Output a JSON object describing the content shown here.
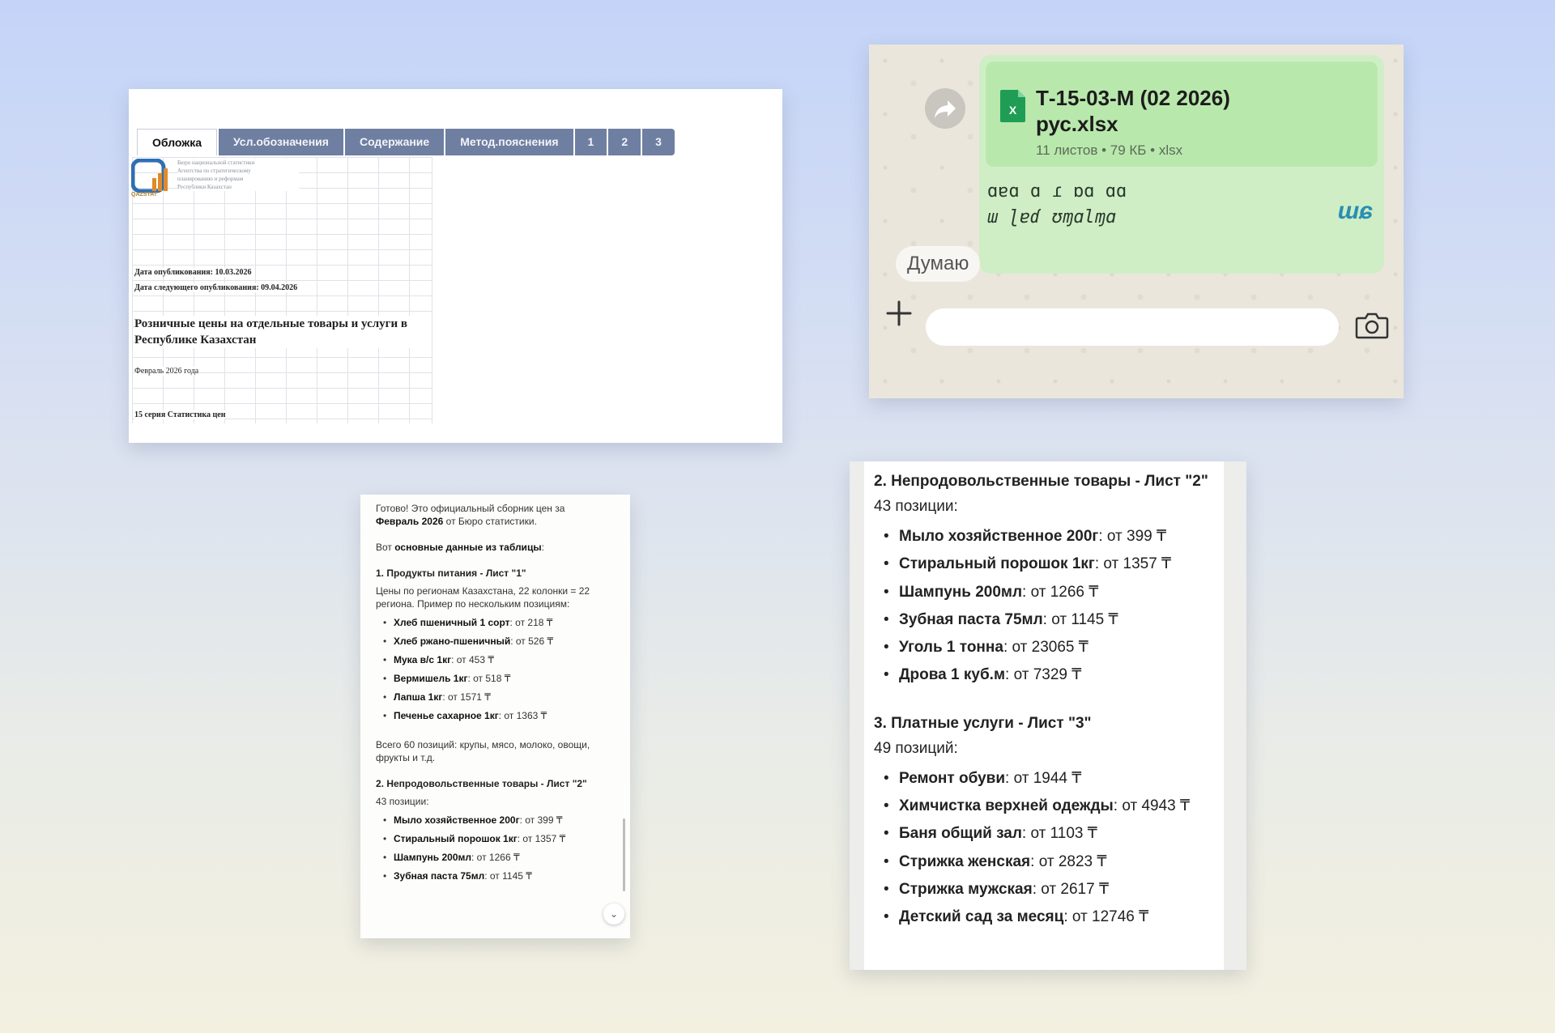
{
  "spreadsheet": {
    "tabs": [
      "Обложка",
      "Усл.обозначения",
      "Содержание",
      "Метод.пояснения",
      "1",
      "2",
      "3"
    ],
    "logo_caption": "QAZSTAT",
    "org_lines": [
      "Бюро национальной статистики",
      "Агентства по стратегическому",
      "планированию и реформам",
      "Республики Казахстан"
    ],
    "published": "Дата опубликования: 10.03.2026",
    "next_published": "Дата следующего опубликования: 09.04.2026",
    "title": "Розничные цены на отдельные товары и услуги в Республике Казахстан",
    "period": "Февраль 2026 года",
    "series": "15 серия Статистика цен"
  },
  "chat": {
    "file_name_line1": "Т-15-03-М (02 2026)",
    "file_name_line2": "рус.xlsx",
    "file_meta": "11 листов • 79 КБ • xlsx",
    "status": "Думаю",
    "icons": {
      "forward": "forward-icon",
      "file": "excel-file-icon",
      "add": "plus-icon",
      "camera": "camera-icon"
    },
    "colors": {
      "bubble": "#cfeec6",
      "file_icon": "#1f9d55"
    }
  },
  "reply": {
    "intro_pre": "Готово! Это официальный сборник цен за ",
    "intro_bold": "Февраль 2026",
    "intro_post": " от Бюро статистики.",
    "lead_pre": "Вот ",
    "lead_bold": "основные данные из таблицы",
    "lead_post": ":",
    "food_heading": "1. Продукты питания - Лист \"1\"",
    "food_desc": "Цены по регионам Казахстана, 22 колонки = 22 региона. Пример по нескольким позициям:",
    "food_items": [
      {
        "name": "Хлеб пшеничный 1 сорт",
        "price": ": от 218 ₸"
      },
      {
        "name": "Хлеб ржано-пшеничный",
        "price": ": от 526 ₸"
      },
      {
        "name": "Мука в/с 1кг",
        "price": ": от 453 ₸"
      },
      {
        "name": "Вермишель 1кг",
        "price": ": от 518 ₸"
      },
      {
        "name": "Лапша 1кг",
        "price": ": от 1571 ₸"
      },
      {
        "name": "Печенье сахарное 1кг",
        "price": ": от 1363 ₸"
      }
    ],
    "food_total": "Всего 60 позиций: крупы, мясо, молоко, овощи, фрукты и т.д.",
    "nonfood_heading": "2. Непродовольственные товары - Лист \"2\"",
    "nonfood_count": "43 позиции:",
    "nonfood_items": [
      {
        "name": "Мыло хозяйственное 200г",
        "price": ": от 399 ₸"
      },
      {
        "name": "Стиральный порошок 1кг",
        "price": ": от 1357 ₸"
      },
      {
        "name": "Шампунь 200мл",
        "price": ": от 1266 ₸"
      },
      {
        "name": "Зубная паста 75мл",
        "price": ": от 1145 ₸"
      }
    ],
    "scroll_icon": "chevron-down-icon"
  },
  "excerpt": {
    "nonfood_heading": "2. Непродовольственные товары - Лист \"2\"",
    "nonfood_count": "43 позиции:",
    "nonfood_items": [
      {
        "name": "Мыло хозяйственное 200г",
        "price": ": от 399 ₸"
      },
      {
        "name": "Стиральный порошок 1кг",
        "price": ": от 1357 ₸"
      },
      {
        "name": "Шампунь 200мл",
        "price": ": от 1266 ₸"
      },
      {
        "name": "Зубная паста 75мл",
        "price": ": от 1145 ₸"
      },
      {
        "name": "Уголь 1 тонна",
        "price": ": от 23065 ₸"
      },
      {
        "name": "Дрова 1 куб.м",
        "price": ": от 7329 ₸"
      }
    ],
    "services_heading": "3. Платные услуги - Лист \"3\"",
    "services_count": "49 позиций:",
    "services_items": [
      {
        "name": "Ремонт обуви",
        "price": ": от 1944 ₸"
      },
      {
        "name": "Химчистка верхней одежды",
        "price": ": от 4943 ₸"
      },
      {
        "name": "Баня общий зал",
        "price": ": от 1103 ₸"
      },
      {
        "name": "Стрижка женская",
        "price": ": от 2823 ₸"
      },
      {
        "name": "Стрижка мужская",
        "price": ": от 2617 ₸"
      },
      {
        "name": "Детский сад за месяц",
        "price": ": от 12746 ₸"
      }
    ]
  }
}
